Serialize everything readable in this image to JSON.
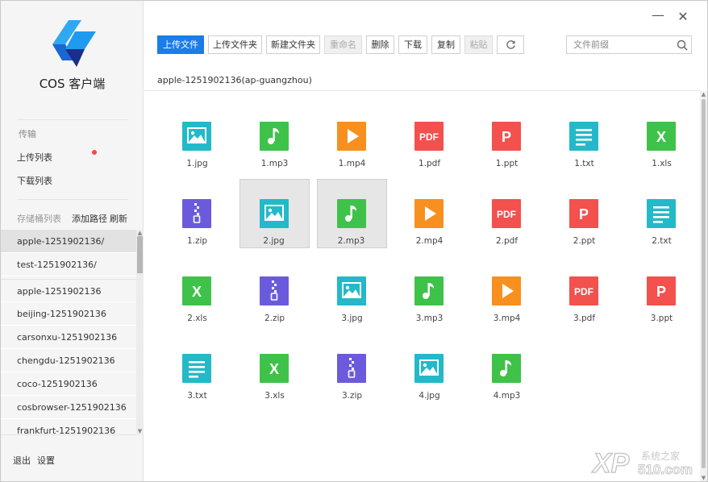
{
  "app": {
    "name": "COS 客户端"
  },
  "sidebar": {
    "transfer_label": "传输",
    "upload_list": "上传列表",
    "download_list": "下载列表",
    "bucket_list_label": "存储桶列表",
    "add_path": "添加路径",
    "refresh": "刷新",
    "buckets": [
      "apple-1251902136/",
      "test-1251902136/",
      "apple-1251902136",
      "beijing-1251902136",
      "carsonxu-1251902136",
      "chengdu-1251902136",
      "coco-1251902136",
      "cosbrowser-1251902136",
      "frankfurt-1251902136"
    ],
    "active_bucket": "apple-1251902136/",
    "logout": "退出",
    "settings": "设置"
  },
  "toolbar": {
    "upload_file": "上传文件",
    "upload_folder": "上传文件夹",
    "new_folder": "新建文件夹",
    "rename": "重命名",
    "delete": "删除",
    "download": "下载",
    "copy": "复制",
    "paste": "粘贴"
  },
  "search": {
    "placeholder": "文件前缀"
  },
  "path": "apple-1251902136(ap-guangzhou)",
  "files": [
    {
      "name": "1.jpg",
      "type": "image",
      "selected": false
    },
    {
      "name": "1.mp3",
      "type": "audio",
      "selected": false
    },
    {
      "name": "1.mp4",
      "type": "video",
      "selected": false
    },
    {
      "name": "1.pdf",
      "type": "pdf",
      "selected": false
    },
    {
      "name": "1.ppt",
      "type": "ppt",
      "selected": false
    },
    {
      "name": "1.txt",
      "type": "txt",
      "selected": false
    },
    {
      "name": "1.xls",
      "type": "xls",
      "selected": false
    },
    {
      "name": "1.zip",
      "type": "zip",
      "selected": false
    },
    {
      "name": "2.jpg",
      "type": "image",
      "selected": true
    },
    {
      "name": "2.mp3",
      "type": "audio",
      "selected": true
    },
    {
      "name": "2.mp4",
      "type": "video",
      "selected": false
    },
    {
      "name": "2.pdf",
      "type": "pdf",
      "selected": false
    },
    {
      "name": "2.ppt",
      "type": "ppt",
      "selected": false
    },
    {
      "name": "2.txt",
      "type": "txt",
      "selected": false
    },
    {
      "name": "2.xls",
      "type": "xls",
      "selected": false
    },
    {
      "name": "2.zip",
      "type": "zip",
      "selected": false
    },
    {
      "name": "3.jpg",
      "type": "image",
      "selected": false
    },
    {
      "name": "3.mp3",
      "type": "audio",
      "selected": false
    },
    {
      "name": "3.mp4",
      "type": "video",
      "selected": false
    },
    {
      "name": "3.pdf",
      "type": "pdf",
      "selected": false
    },
    {
      "name": "3.ppt",
      "type": "ppt",
      "selected": false
    },
    {
      "name": "3.txt",
      "type": "txt",
      "selected": false
    },
    {
      "name": "3.xls",
      "type": "xls",
      "selected": false
    },
    {
      "name": "3.zip",
      "type": "zip",
      "selected": false
    },
    {
      "name": "4.jpg",
      "type": "image",
      "selected": false
    },
    {
      "name": "4.mp3",
      "type": "audio",
      "selected": false
    }
  ],
  "type_colors": {
    "image": "#23b9c9",
    "audio": "#3fc24a",
    "video": "#f7901e",
    "pdf": "#f2514e",
    "ppt": "#f2514e",
    "txt": "#23b9c9",
    "xls": "#3fc24a",
    "zip": "#6b5bdc"
  },
  "watermark": {
    "text": "XP 系统之家 510.com"
  },
  "colors": {
    "accent": "#1a7de8",
    "notify_dot": "#f04a4a"
  }
}
